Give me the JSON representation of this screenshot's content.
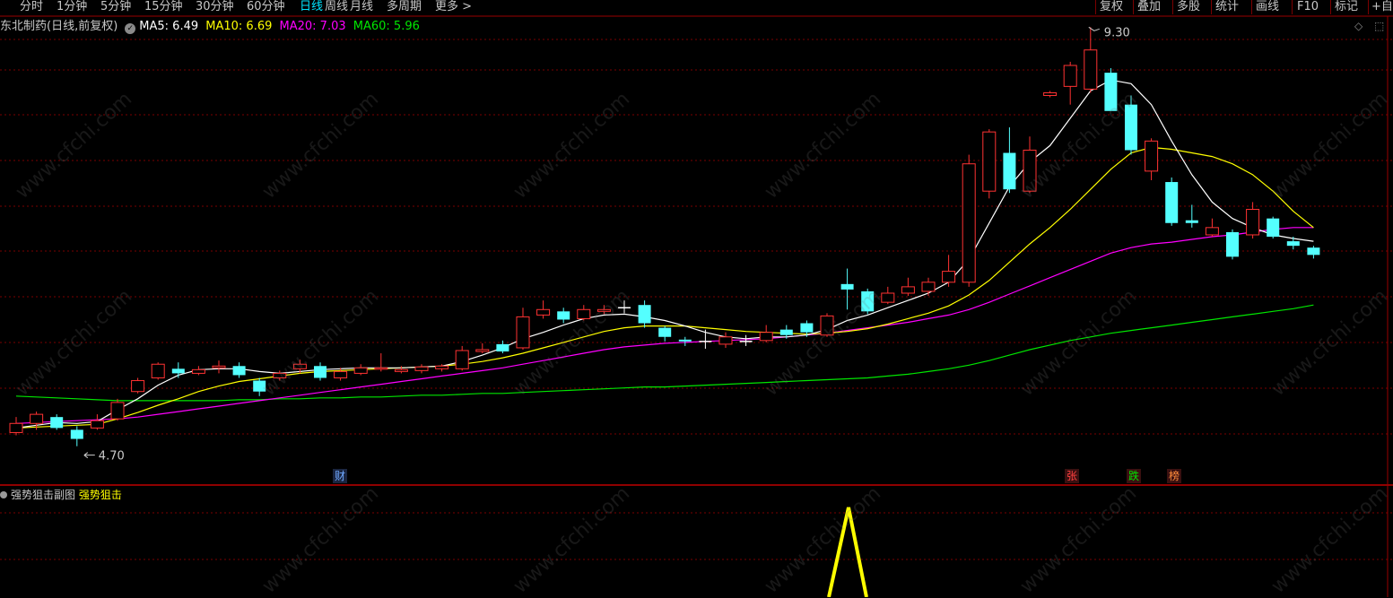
{
  "toolbar": {
    "left": [
      "分时",
      "1分钟",
      "5分钟",
      "15分钟",
      "30分钟",
      "60分钟",
      "日线",
      "周线",
      "月线",
      "多周期",
      "更多 >"
    ],
    "active": "日线",
    "right": [
      "复权",
      "叠加",
      "多股",
      "统计",
      "画线",
      "F10",
      "标记",
      "+自"
    ]
  },
  "info": {
    "title": "东北制药(日线,前复权)",
    "ma5": "MA5: 6.49",
    "ma10": "MA10: 6.69",
    "ma20": "MA20: 7.03",
    "ma60": "MA60: 5.96"
  },
  "colors": {
    "up": "#ff3232",
    "down": "#54ffff",
    "ma5": "#ffffff",
    "ma10": "#ffff00",
    "ma20": "#ff00ff",
    "ma60": "#00e600",
    "grid": "#7a0000",
    "indicator": "#ffff00"
  },
  "corner": {
    "diamond": "◇",
    "expand": "⬚"
  },
  "annotations": {
    "high": "9.30",
    "low": "4.70"
  },
  "signals": [
    {
      "label": "财",
      "color": "#6fa8ff"
    },
    {
      "label": "张",
      "color": "#ff4040"
    },
    {
      "label": "跌",
      "color": "#00e600"
    },
    {
      "label": "榜",
      "color": "#ff8c3c"
    }
  ],
  "sub_panel": {
    "name": "强势狙击副图",
    "indicator": "强势狙击"
  },
  "watermark": "www.cfchi.com",
  "chart_data": {
    "type": "candlestick",
    "price_range": [
      4.5,
      9.5
    ],
    "candles": [
      {
        "o": 4.85,
        "c": 4.95,
        "h": 5.02,
        "l": 4.82
      },
      {
        "o": 4.95,
        "c": 5.05,
        "h": 5.08,
        "l": 4.88
      },
      {
        "o": 5.02,
        "c": 4.9,
        "h": 5.05,
        "l": 4.88
      },
      {
        "o": 4.88,
        "c": 4.78,
        "h": 4.92,
        "l": 4.7
      },
      {
        "o": 4.9,
        "c": 4.98,
        "h": 5.05,
        "l": 4.88
      },
      {
        "o": 5.0,
        "c": 5.18,
        "h": 5.22,
        "l": 4.98
      },
      {
        "o": 5.3,
        "c": 5.42,
        "h": 5.45,
        "l": 5.28
      },
      {
        "o": 5.45,
        "c": 5.6,
        "h": 5.62,
        "l": 5.43
      },
      {
        "o": 5.55,
        "c": 5.5,
        "h": 5.62,
        "l": 5.45
      },
      {
        "o": 5.5,
        "c": 5.54,
        "h": 5.58,
        "l": 5.48
      },
      {
        "o": 5.56,
        "c": 5.58,
        "h": 5.64,
        "l": 5.5
      },
      {
        "o": 5.58,
        "c": 5.48,
        "h": 5.62,
        "l": 5.45
      },
      {
        "o": 5.42,
        "c": 5.3,
        "h": 5.45,
        "l": 5.25
      },
      {
        "o": 5.45,
        "c": 5.5,
        "h": 5.53,
        "l": 5.42
      },
      {
        "o": 5.55,
        "c": 5.6,
        "h": 5.65,
        "l": 5.5
      },
      {
        "o": 5.58,
        "c": 5.45,
        "h": 5.62,
        "l": 5.42
      },
      {
        "o": 5.45,
        "c": 5.52,
        "h": 5.56,
        "l": 5.42
      },
      {
        "o": 5.5,
        "c": 5.56,
        "h": 5.6,
        "l": 5.48
      },
      {
        "o": 5.55,
        "c": 5.56,
        "h": 5.72,
        "l": 5.52
      },
      {
        "o": 5.52,
        "c": 5.54,
        "h": 5.58,
        "l": 5.5
      },
      {
        "o": 5.53,
        "c": 5.57,
        "h": 5.6,
        "l": 5.5
      },
      {
        "o": 5.55,
        "c": 5.58,
        "h": 5.6,
        "l": 5.52
      },
      {
        "o": 5.55,
        "c": 5.75,
        "h": 5.8,
        "l": 5.53
      },
      {
        "o": 5.74,
        "c": 5.76,
        "h": 5.83,
        "l": 5.72
      },
      {
        "o": 5.82,
        "c": 5.74,
        "h": 5.86,
        "l": 5.72
      },
      {
        "o": 5.78,
        "c": 6.12,
        "h": 6.22,
        "l": 5.76
      },
      {
        "o": 6.14,
        "c": 6.2,
        "h": 6.3,
        "l": 6.1
      },
      {
        "o": 6.18,
        "c": 6.09,
        "h": 6.22,
        "l": 6.05
      },
      {
        "o": 6.1,
        "c": 6.2,
        "h": 6.25,
        "l": 6.08
      },
      {
        "o": 6.18,
        "c": 6.2,
        "h": 6.25,
        "l": 6.15
      },
      {
        "o": 6.22,
        "c": 6.22,
        "h": 6.3,
        "l": 6.16
      },
      {
        "o": 6.25,
        "c": 6.05,
        "h": 6.3,
        "l": 6.0
      },
      {
        "o": 6.0,
        "c": 5.9,
        "h": 6.02,
        "l": 5.85
      },
      {
        "o": 5.87,
        "c": 5.85,
        "h": 5.9,
        "l": 5.8
      },
      {
        "o": 5.85,
        "c": 5.85,
        "h": 5.98,
        "l": 5.77
      },
      {
        "o": 5.82,
        "c": 5.9,
        "h": 5.95,
        "l": 5.78
      },
      {
        "o": 5.85,
        "c": 5.85,
        "h": 5.92,
        "l": 5.8
      },
      {
        "o": 5.86,
        "c": 5.95,
        "h": 6.03,
        "l": 5.84
      },
      {
        "o": 5.98,
        "c": 5.92,
        "h": 6.03,
        "l": 5.88
      },
      {
        "o": 6.05,
        "c": 5.95,
        "h": 6.08,
        "l": 5.9
      },
      {
        "o": 5.92,
        "c": 6.13,
        "h": 6.16,
        "l": 5.9
      },
      {
        "o": 6.48,
        "c": 6.42,
        "h": 6.65,
        "l": 6.2
      },
      {
        "o": 6.4,
        "c": 6.18,
        "h": 6.43,
        "l": 6.15
      },
      {
        "o": 6.28,
        "c": 6.38,
        "h": 6.45,
        "l": 6.26
      },
      {
        "o": 6.38,
        "c": 6.45,
        "h": 6.55,
        "l": 6.35
      },
      {
        "o": 6.4,
        "c": 6.5,
        "h": 6.55,
        "l": 6.35
      },
      {
        "o": 6.5,
        "c": 6.62,
        "h": 6.8,
        "l": 6.45
      },
      {
        "o": 6.5,
        "c": 7.8,
        "h": 7.9,
        "l": 6.45
      },
      {
        "o": 7.5,
        "c": 8.15,
        "h": 8.18,
        "l": 7.42
      },
      {
        "o": 7.92,
        "c": 7.52,
        "h": 8.2,
        "l": 7.48
      },
      {
        "o": 7.5,
        "c": 7.95,
        "h": 8.1,
        "l": 7.48
      },
      {
        "o": 8.55,
        "c": 8.58,
        "h": 8.6,
        "l": 8.53
      },
      {
        "o": 8.65,
        "c": 8.88,
        "h": 8.92,
        "l": 8.45
      },
      {
        "o": 8.62,
        "c": 9.05,
        "h": 9.3,
        "l": 8.58
      },
      {
        "o": 8.8,
        "c": 8.38,
        "h": 8.85,
        "l": 8.38
      },
      {
        "o": 8.45,
        "c": 7.95,
        "h": 8.55,
        "l": 7.9
      },
      {
        "o": 7.72,
        "c": 8.05,
        "h": 8.08,
        "l": 7.62
      },
      {
        "o": 7.6,
        "c": 7.15,
        "h": 7.65,
        "l": 7.12
      },
      {
        "o": 7.18,
        "c": 7.15,
        "h": 7.35,
        "l": 7.1
      },
      {
        "o": 7.02,
        "c": 7.1,
        "h": 7.2,
        "l": 7.0
      },
      {
        "o": 7.05,
        "c": 6.78,
        "h": 7.08,
        "l": 6.75
      },
      {
        "o": 7.02,
        "c": 7.3,
        "h": 7.38,
        "l": 6.98
      },
      {
        "o": 7.2,
        "c": 7.0,
        "h": 7.22,
        "l": 6.98
      },
      {
        "o": 6.95,
        "c": 6.9,
        "h": 7.0,
        "l": 6.86
      },
      {
        "o": 6.88,
        "c": 6.8,
        "h": 6.9,
        "l": 6.76
      }
    ],
    "ma5": [
      4.9,
      4.93,
      4.96,
      4.95,
      4.97,
      5.1,
      5.22,
      5.37,
      5.48,
      5.54,
      5.55,
      5.55,
      5.52,
      5.5,
      5.52,
      5.54,
      5.55,
      5.56,
      5.56,
      5.56,
      5.57,
      5.58,
      5.63,
      5.7,
      5.78,
      5.88,
      5.95,
      6.03,
      6.1,
      6.14,
      6.15,
      6.12,
      6.08,
      6.02,
      5.95,
      5.9,
      5.88,
      5.9,
      5.9,
      5.92,
      5.98,
      6.08,
      6.14,
      6.22,
      6.3,
      6.38,
      6.5,
      6.75,
      7.15,
      7.55,
      7.82,
      8.0,
      8.3,
      8.6,
      8.72,
      8.68,
      8.45,
      8.05,
      7.68,
      7.38,
      7.2,
      7.1,
      7.02,
      6.98,
      6.95
    ],
    "ma10": [
      4.9,
      4.91,
      4.92,
      4.93,
      4.94,
      5.0,
      5.07,
      5.15,
      5.22,
      5.3,
      5.36,
      5.41,
      5.44,
      5.47,
      5.5,
      5.52,
      5.53,
      5.54,
      5.55,
      5.56,
      5.57,
      5.58,
      5.6,
      5.63,
      5.67,
      5.72,
      5.78,
      5.84,
      5.9,
      5.96,
      6.0,
      6.02,
      6.02,
      6.02,
      6.0,
      5.98,
      5.96,
      5.95,
      5.94,
      5.93,
      5.94,
      5.96,
      5.99,
      6.04,
      6.1,
      6.16,
      6.24,
      6.36,
      6.52,
      6.72,
      6.92,
      7.1,
      7.3,
      7.52,
      7.74,
      7.92,
      7.98,
      7.96,
      7.92,
      7.88,
      7.8,
      7.68,
      7.5,
      7.28,
      7.1
    ],
    "ma20": [
      4.95,
      4.96,
      4.97,
      4.98,
      4.99,
      5.0,
      5.02,
      5.05,
      5.08,
      5.11,
      5.14,
      5.17,
      5.2,
      5.23,
      5.26,
      5.29,
      5.32,
      5.35,
      5.38,
      5.41,
      5.44,
      5.47,
      5.5,
      5.53,
      5.56,
      5.6,
      5.64,
      5.68,
      5.72,
      5.76,
      5.79,
      5.81,
      5.83,
      5.84,
      5.85,
      5.86,
      5.87,
      5.88,
      5.9,
      5.92,
      5.94,
      5.97,
      6.0,
      6.03,
      6.06,
      6.1,
      6.14,
      6.2,
      6.28,
      6.37,
      6.46,
      6.55,
      6.64,
      6.73,
      6.82,
      6.88,
      6.92,
      6.94,
      6.97,
      7.0,
      7.02,
      7.05,
      7.08,
      7.1,
      7.1
    ],
    "ma60": [
      5.25,
      5.24,
      5.23,
      5.22,
      5.21,
      5.2,
      5.2,
      5.2,
      5.2,
      5.2,
      5.2,
      5.21,
      5.21,
      5.22,
      5.22,
      5.23,
      5.23,
      5.24,
      5.24,
      5.25,
      5.26,
      5.26,
      5.27,
      5.28,
      5.28,
      5.29,
      5.3,
      5.31,
      5.32,
      5.33,
      5.34,
      5.35,
      5.35,
      5.36,
      5.37,
      5.38,
      5.39,
      5.4,
      5.41,
      5.42,
      5.43,
      5.44,
      5.45,
      5.47,
      5.49,
      5.52,
      5.55,
      5.59,
      5.64,
      5.7,
      5.76,
      5.81,
      5.86,
      5.9,
      5.94,
      5.97,
      6.0,
      6.03,
      6.06,
      6.09,
      6.12,
      6.15,
      6.18,
      6.21,
      6.25
    ],
    "indicator": {
      "name": "强势狙击",
      "type": "line",
      "spike_candle_index": 40
    }
  }
}
